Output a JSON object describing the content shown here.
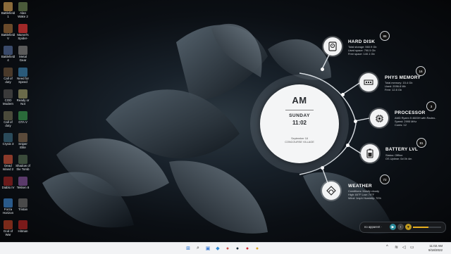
{
  "desktop_icons": [
    {
      "label": "Battlefield 1",
      "color": "#8a6a3a"
    },
    {
      "label": "Alan Wake 2 (extract)",
      "color": "#4a5a3a"
    },
    {
      "label": "Battlefield V",
      "color": "#6a4a2a"
    },
    {
      "label": "Marvel's Spider-Man",
      "color": "#a02828"
    },
    {
      "label": "Battlefield 4",
      "color": "#3a4a6a"
    },
    {
      "label": "Metal Gear",
      "color": "#5a5a5a"
    },
    {
      "label": "Call of duty",
      "color": "#4a3a2a"
    },
    {
      "label": "Need for Speed",
      "color": "#2a5a7a"
    },
    {
      "label": "COD Modern",
      "color": "#3a3a3a"
    },
    {
      "label": "Ready or Not",
      "color": "#6a6a4a"
    },
    {
      "label": "Call of duty",
      "color": "#4a4a3a"
    },
    {
      "label": "GTA V",
      "color": "#2a6a3a"
    },
    {
      "label": "Crysis 3",
      "color": "#2a4a5a"
    },
    {
      "label": "Sniper Elite",
      "color": "#5a4a3a"
    },
    {
      "label": "Dead Island 2",
      "color": "#8a3a2a"
    },
    {
      "label": "Shadow of the Tomb",
      "color": "#3a4a3a"
    },
    {
      "label": "Diablo IV",
      "color": "#6a1a1a"
    },
    {
      "label": "Tekken 8",
      "color": "#5a3a6a"
    },
    {
      "label": "Forza Horizon",
      "color": "#2a5a8a"
    },
    {
      "label": "Tristan",
      "color": "#4a4a4a"
    },
    {
      "label": "God of War",
      "color": "#7a2a1a"
    },
    {
      "label": "Hitman",
      "color": "#7a1a1a"
    }
  ],
  "clock": {
    "ampm": "AM",
    "day": "SUNDAY",
    "time": "11:02",
    "date": "September 18",
    "location": "CONCOURSE VILLAGE"
  },
  "panels": {
    "disk": {
      "title": "HARD DISK",
      "badge": "85",
      "icon": "hard-disk-icon",
      "lines": [
        "Total storage: 560.9 Gb",
        "Used space: 790.5 Gb",
        "Free space: 140.1 Gb"
      ]
    },
    "memory": {
      "title": "PHYS MEMORY",
      "badge": "16",
      "icon": "memory-icon",
      "lines": [
        "Total memory: 15.4 Gb",
        "Used: 2096.8 Mb",
        "Free: 12.8 Gb"
      ]
    },
    "processor": {
      "title": "PROCESSOR",
      "badge": "3",
      "icon": "cpu-icon",
      "lines": [
        "AMD Ryzen 5 4600H with Radeo..",
        "Speed: 2995 MHz",
        "Cores: 12"
      ]
    },
    "battery": {
      "title": "BATTERY LVL",
      "badge": "81",
      "icon": "battery-icon",
      "lines": [
        "Status: Offline",
        "OS Uptime: 0d 0h 4m"
      ]
    },
    "weather": {
      "title": "WEATHER",
      "badge": "72",
      "icon": "weather-icon",
      "lines": [
        "Conditions: Mostly cloudy",
        "High: 84°F   Low: 70°F",
        "Wind: 1mph   Humidity: 70%"
      ]
    }
  },
  "audio": {
    "label": "no apparent ·",
    "progress": 0.55
  },
  "taskbar": {
    "apps": [
      {
        "name": "windows-start-icon",
        "glyph": "⊞",
        "color": "#1f6fd0"
      },
      {
        "name": "search-icon",
        "glyph": "⌕",
        "color": "#333333"
      },
      {
        "name": "task-view-icon",
        "glyph": "▣",
        "color": "#3a7bd5"
      },
      {
        "name": "widgets-icon",
        "glyph": "◆",
        "color": "#2a8ad8"
      },
      {
        "name": "chrome-icon",
        "glyph": "●",
        "color": "#d84a3a"
      },
      {
        "name": "steam-icon",
        "glyph": "●",
        "color": "#1b2838"
      },
      {
        "name": "opera-icon",
        "glyph": "●",
        "color": "#d4262b"
      },
      {
        "name": "chrome-alt-icon",
        "glyph": "●",
        "color": "#e0a020"
      }
    ],
    "time": "11:02 AM",
    "date": "9/18/2022"
  }
}
